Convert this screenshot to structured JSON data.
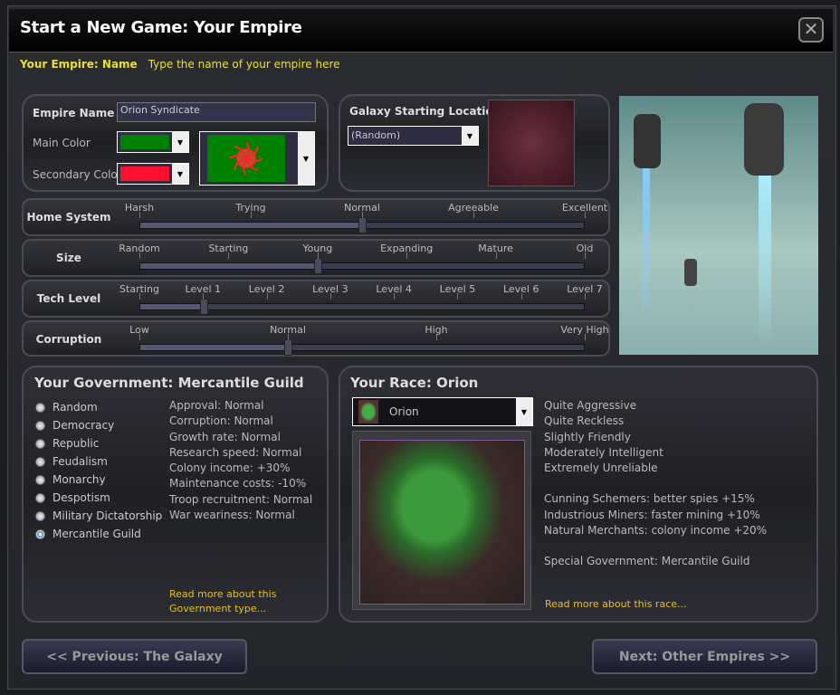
{
  "title": "Start a New Game: Your Empire",
  "hint": {
    "label": "Your Empire: Name",
    "text": "Type the name of your empire here"
  },
  "empire": {
    "name_label": "Empire Name",
    "name_value": "Orion Syndicate",
    "main_color_label": "Main Color",
    "secondary_color_label": "Secondary Color",
    "main_color": "#008000",
    "secondary_color": "#ff1030"
  },
  "galaxy": {
    "label": "Galaxy Starting Location",
    "value": "(Random)"
  },
  "sliders": [
    {
      "label": "Home System",
      "stops": [
        "Harsh",
        "Trying",
        "Normal",
        "Agreeable",
        "Excellent"
      ],
      "selected": 2
    },
    {
      "label": "Size",
      "stops": [
        "Random",
        "Starting",
        "Young",
        "Expanding",
        "Mature",
        "Old"
      ],
      "selected": 2
    },
    {
      "label": "Tech Level",
      "stops": [
        "Starting",
        "Level 1",
        "Level 2",
        "Level 3",
        "Level 4",
        "Level 5",
        "Level 6",
        "Level 7"
      ],
      "selected": 1
    },
    {
      "label": "Corruption",
      "stops": [
        "Low",
        "Normal",
        "High",
        "Very High"
      ],
      "selected": 1
    }
  ],
  "government": {
    "title": "Your Government: Mercantile Guild",
    "options": [
      "Random",
      "Democracy",
      "Republic",
      "Feudalism",
      "Monarchy",
      "Despotism",
      "Military Dictatorship",
      "Mercantile Guild"
    ],
    "selected": 7,
    "stats": [
      "Approval: Normal",
      "Corruption: Normal",
      "Growth rate: Normal",
      "Research speed: Normal",
      "Colony income: +30%",
      "Maintenance costs: -10%",
      "Troop recruitment: Normal",
      "War weariness: Normal"
    ],
    "link": "Read more about this Government type..."
  },
  "race": {
    "title": "Your Race: Orion",
    "selected": "Orion",
    "traits": [
      "Quite Aggressive",
      "Quite Reckless",
      "Slightly Friendly",
      "Moderately Intelligent",
      "Extremely Unreliable"
    ],
    "abilities": [
      "Cunning Schemers: better spies +15%",
      "Industrious Miners: faster mining +10%",
      "Natural Merchants: colony income +20%"
    ],
    "special": "Special Government: Mercantile Guild",
    "link": "Read more about this race..."
  },
  "buttons": {
    "prev": "<< Previous: The Galaxy",
    "next": "Next: Other Empires >>"
  }
}
